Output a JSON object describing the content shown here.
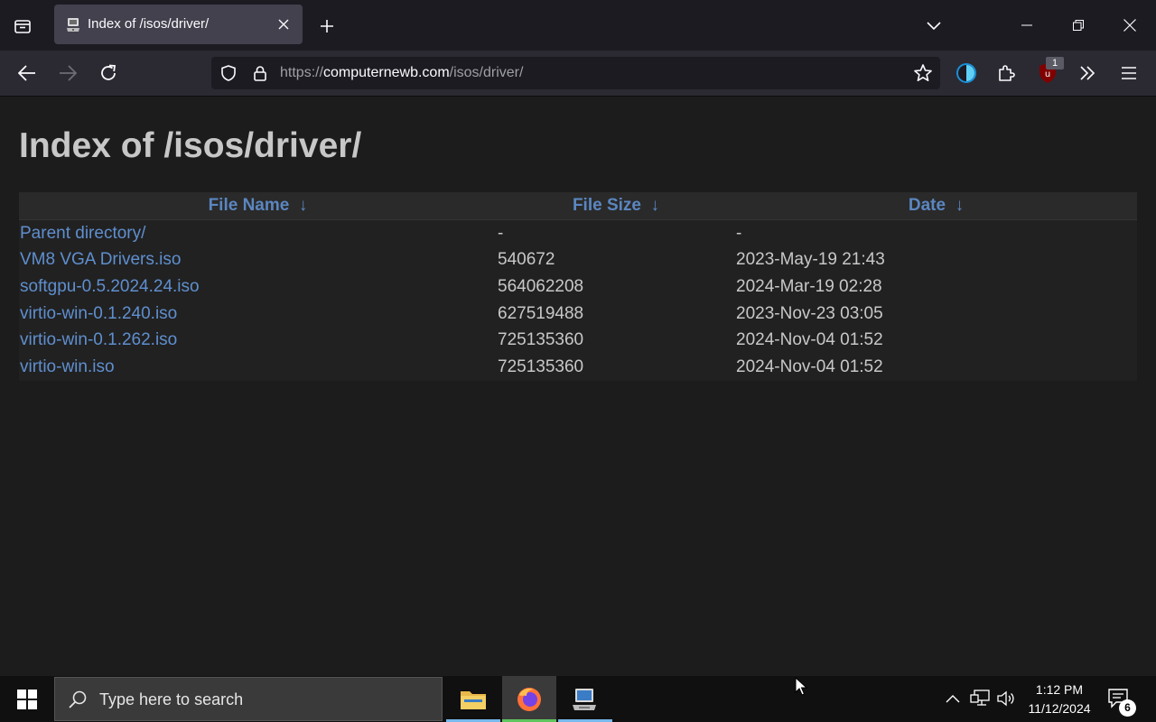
{
  "browser": {
    "tab": {
      "title": "Index of /isos/driver/"
    },
    "url": {
      "scheme": "https://",
      "host": "computernewb.com",
      "path": "/isos/driver/"
    },
    "extension_badge": "1"
  },
  "page": {
    "title": "Index of /isos/driver/",
    "columns": [
      {
        "label": "File Name",
        "sort": "↓"
      },
      {
        "label": "File Size",
        "sort": "↓"
      },
      {
        "label": "Date",
        "sort": "↓"
      }
    ],
    "rows": [
      {
        "name": "Parent directory/",
        "size": "-",
        "date": "-"
      },
      {
        "name": "VM8 VGA Drivers.iso",
        "size": "540672",
        "date": "2023-May-19 21:43"
      },
      {
        "name": "softgpu-0.5.2024.24.iso",
        "size": "564062208",
        "date": "2024-Mar-19 02:28"
      },
      {
        "name": "virtio-win-0.1.240.iso",
        "size": "627519488",
        "date": "2023-Nov-23 03:05"
      },
      {
        "name": "virtio-win-0.1.262.iso",
        "size": "725135360",
        "date": "2024-Nov-04 01:52"
      },
      {
        "name": "virtio-win.iso",
        "size": "725135360",
        "date": "2024-Nov-04 01:52"
      }
    ]
  },
  "taskbar": {
    "search_placeholder": "Type here to search",
    "time": "1:12 PM",
    "date": "11/12/2024",
    "notification_count": "6",
    "apps": [
      "file-explorer",
      "firefox",
      "remote-desktop"
    ]
  },
  "colors": {
    "link": "#5f8fcf",
    "header_link": "#5b86c0",
    "page_background": "#1c1c1c",
    "browser_chrome": "#2b2a33"
  }
}
